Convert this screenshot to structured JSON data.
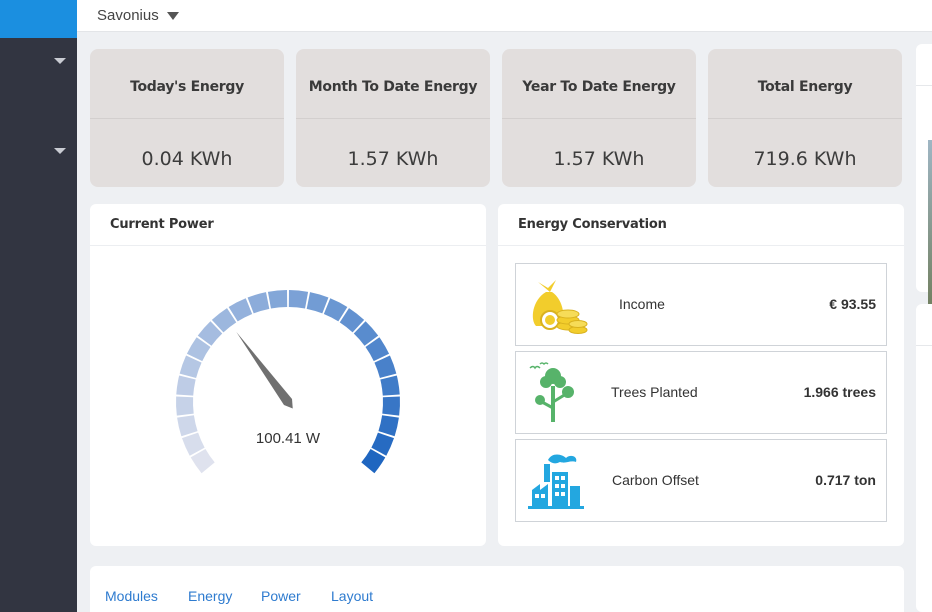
{
  "header": {
    "site": "Savonius"
  },
  "stats": [
    {
      "label": "Today's Energy",
      "value": "0.04 KWh"
    },
    {
      "label": "Month To Date Energy",
      "value": "1.57 KWh"
    },
    {
      "label": "Year To Date Energy",
      "value": "1.57 KWh"
    },
    {
      "label": "Total Energy",
      "value": "719.6 KWh"
    }
  ],
  "current_power": {
    "title": "Current Power",
    "value_text": "100.41 W",
    "gauge_fraction": 0.36,
    "colors": {
      "low": "#dfe2ee",
      "high": "#1f66c0"
    }
  },
  "conservation": {
    "title": "Energy Conservation",
    "items": [
      {
        "label": "Income",
        "value": "€ 93.55",
        "icon": "money-bag-coins-icon",
        "color": "#f2cd2c"
      },
      {
        "label": "Trees Planted",
        "value": "1.966 trees",
        "icon": "trees-icon",
        "color": "#57b36a"
      },
      {
        "label": "Carbon Offset",
        "value": "0.717 ton",
        "icon": "factory-icon",
        "color": "#23a7e0"
      }
    ]
  },
  "tabs": [
    {
      "label": "Modules"
    },
    {
      "label": "Energy"
    },
    {
      "label": "Power"
    },
    {
      "label": "Layout"
    }
  ]
}
